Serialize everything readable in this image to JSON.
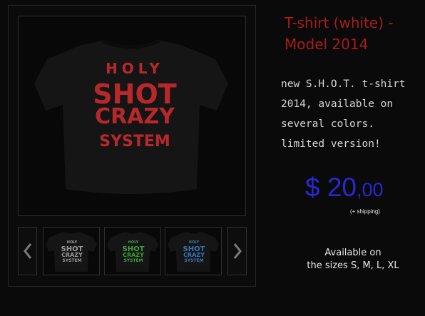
{
  "product": {
    "title": "T-shirt (white) - Model 2014",
    "description": "new S.H.O.T. t-shirt 2014, available on several colors. limited version!",
    "price": {
      "currency": "$",
      "whole": "20",
      "cents": ",00",
      "shipping_note": "(+ shipping)"
    },
    "availability": {
      "line1": "Available on",
      "line2": "the sizes S, M, L, XL"
    }
  },
  "shirt_print": {
    "line1": "HOLY",
    "line2": "SHOT",
    "line3": "CRAZY",
    "line4": "SYSTEM"
  },
  "gallery": {
    "main_print_color": "#b8282b",
    "thumbnails": [
      {
        "print_color": "#9a9a9a"
      },
      {
        "print_color": "#3fa03a"
      },
      {
        "print_color": "#3a74b8"
      }
    ]
  },
  "colors": {
    "title": "#a81c1c",
    "price": "#2828d2",
    "background": "#0a0a0a"
  },
  "icons": {
    "prev": "chevron-left-icon",
    "next": "chevron-right-icon"
  }
}
